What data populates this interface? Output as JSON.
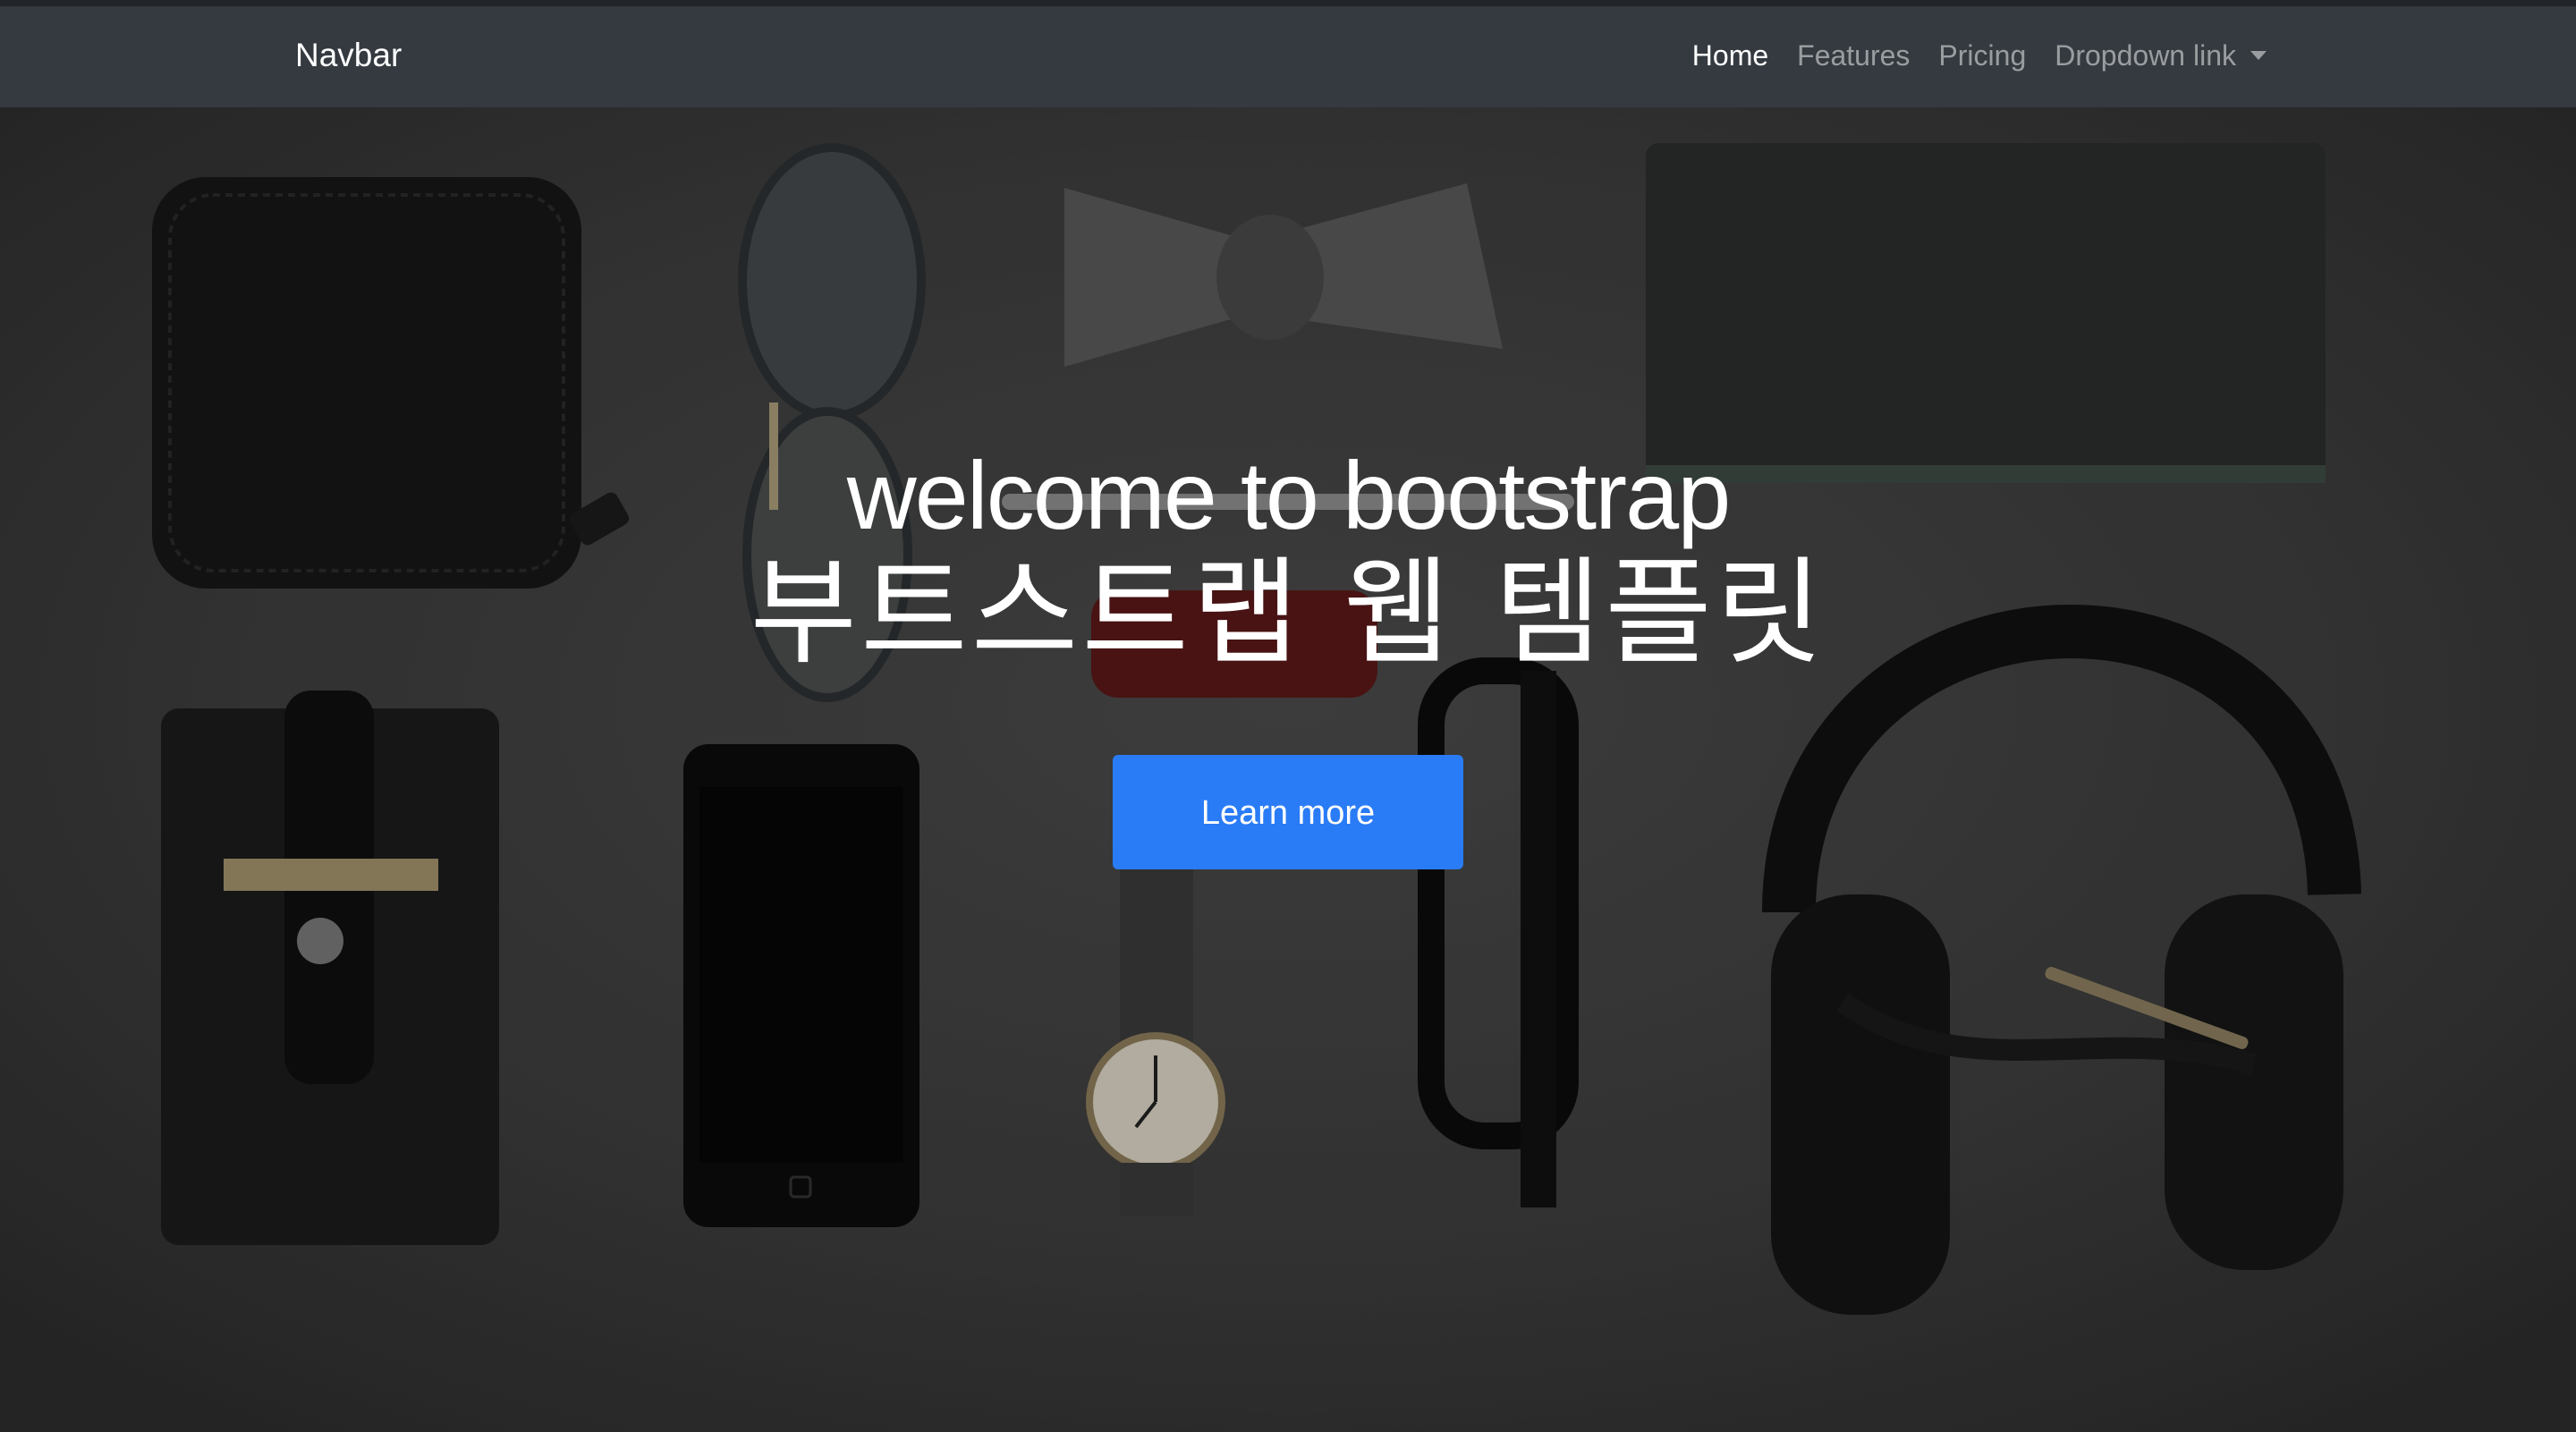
{
  "navbar": {
    "brand": "Navbar",
    "links": [
      {
        "label": "Home",
        "active": true
      },
      {
        "label": "Features",
        "active": false
      },
      {
        "label": "Pricing",
        "active": false
      },
      {
        "label": "Dropdown link",
        "active": false,
        "dropdown": true
      }
    ],
    "background": "#343a40"
  },
  "hero": {
    "title": "welcome to bootstrap",
    "subtitle": "부트스트랩 웹 템플릿",
    "cta_label": "Learn more",
    "cta_color": "#2a7cf6",
    "background_image": "flat-lay-accessories-photo"
  }
}
